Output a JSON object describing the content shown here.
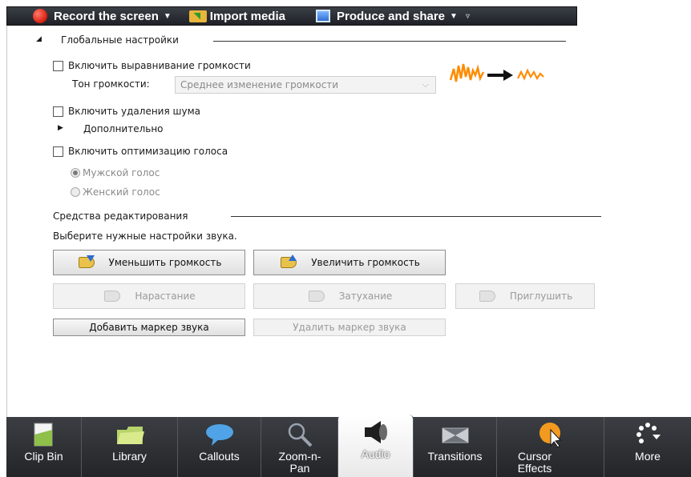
{
  "toolbar": {
    "record_label": "Record the screen",
    "import_label": "Import media",
    "produce_label": "Produce and share"
  },
  "global_settings": {
    "title": "Глобальные настройки",
    "volume_leveling_label": "Включить выравнивание громкости",
    "volume_tone_label": "Тон громкости:",
    "volume_tone_value": "Среднее изменение громкости",
    "noise_removal_label": "Включить удаления шума",
    "advanced_label": "Дополнительно",
    "voice_optimization_label": "Включить оптимизацию голоса",
    "male_voice_label": "Мужской голос",
    "female_voice_label": "Женский голос",
    "leveling_colors": {
      "wave": "#ff8c00",
      "arrow": "#111111"
    }
  },
  "editing_tools": {
    "title": "Средства редактирования",
    "hint": "Выберите нужные настройки звука.",
    "decrease_volume": "Уменьшить громкость",
    "increase_volume": "Увеличить громкость",
    "fade_in": "Нарастание",
    "fade_out": "Затухание",
    "silence": "Приглушить",
    "add_marker": "Добавить маркер звука",
    "remove_marker": "Удалить маркер звука"
  },
  "dock": {
    "items": [
      {
        "label": "Clip Bin",
        "icon": "clip-bin-icon"
      },
      {
        "label": "Library",
        "icon": "library-icon"
      },
      {
        "label": "Callouts",
        "icon": "callouts-icon"
      },
      {
        "label": "Zoom-n-Pan",
        "icon": "zoom-icon"
      },
      {
        "label": "Audio",
        "icon": "audio-icon",
        "active": true
      },
      {
        "label": "Transitions",
        "icon": "transitions-icon"
      },
      {
        "label": "Cursor Effects",
        "icon": "cursor-effects-icon"
      },
      {
        "label": "More",
        "icon": "more-icon"
      }
    ]
  }
}
